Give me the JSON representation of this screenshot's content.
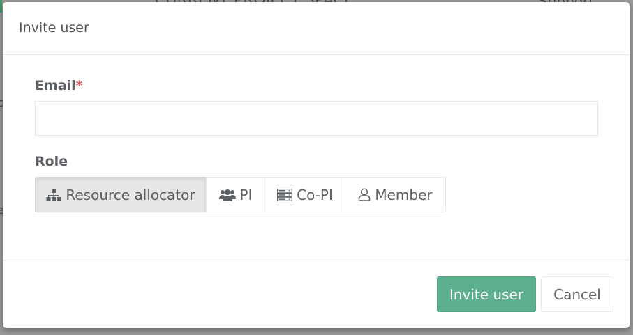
{
  "background": {
    "partial_text_left": "CURRENT PROJECT SPACE",
    "partial_text_right": "Support",
    "edge_text_1": "c",
    "edge_text_2": "e"
  },
  "modal": {
    "title": "Invite user",
    "email": {
      "label": "Email",
      "required_marker": "*",
      "value": "",
      "placeholder": ""
    },
    "role": {
      "label": "Role",
      "selected": "Resource allocator",
      "options": [
        {
          "label": "Resource allocator",
          "icon": "sitemap-icon"
        },
        {
          "label": "PI",
          "icon": "users-icon"
        },
        {
          "label": "Co-PI",
          "icon": "server-icon"
        },
        {
          "label": "Member",
          "icon": "user-outline-icon"
        }
      ]
    },
    "footer": {
      "invite_label": "Invite user",
      "cancel_label": "Cancel"
    }
  },
  "colors": {
    "primary": "#5cb08e",
    "required": "#d9534f",
    "text": "#5d6064"
  }
}
